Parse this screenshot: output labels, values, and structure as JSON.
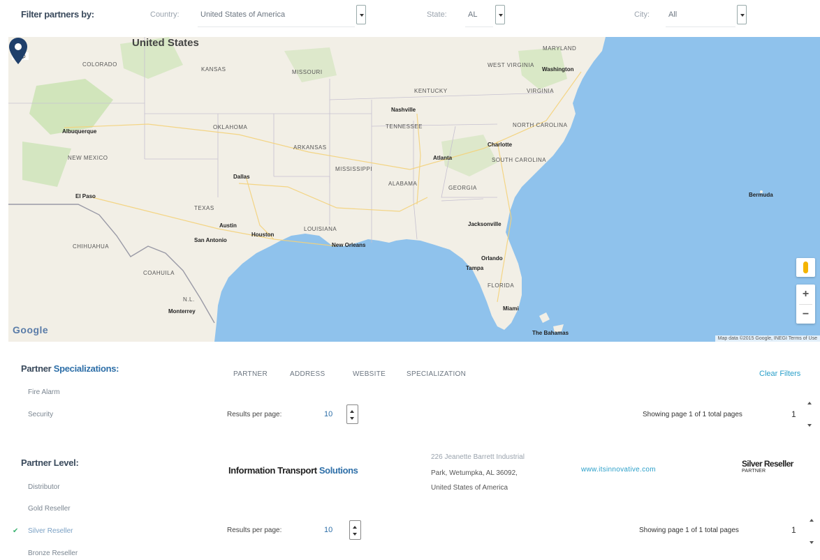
{
  "filters": {
    "title": "Filter partners by:",
    "country_label": "Country:",
    "country_value": "United States of America",
    "state_label": "State:",
    "state_value": "AL",
    "city_label": "City:",
    "city_value": "All"
  },
  "map": {
    "country_label": "United States",
    "map_type": "Map",
    "google_logo": "Google",
    "attribution": "Map data ©2015 Google, INEGI   Terms of Use",
    "zoom_in": "+",
    "zoom_out": "−",
    "colors": {
      "water": "#8fc2ec",
      "land": "#f2efe6",
      "park": "#c8e2b0",
      "marker": "#1f3f6b"
    },
    "state_labels": [
      "Colorado",
      "Kansas",
      "Missouri",
      "Kentucky",
      "Virginia",
      "Maryland",
      "West Virginia",
      "Tennessee",
      "North Carolina",
      "South Carolina",
      "Oklahoma",
      "Arkansas",
      "Mississippi",
      "Alabama",
      "Georgia",
      "Texas",
      "Louisiana",
      "Florida",
      "New Mexico",
      "Chihuahua",
      "Coahuila",
      "N.L."
    ],
    "city_labels": [
      "Washington",
      "Nashville",
      "Charlotte",
      "Atlanta",
      "Dallas",
      "Albuquerque",
      "El Paso",
      "Austin",
      "Houston",
      "San Antonio",
      "New Orleans",
      "Jacksonville",
      "Orlando",
      "Tampa",
      "Miami",
      "Monterrey",
      "The Bahamas",
      "Bermuda"
    ]
  },
  "sidebar": {
    "specializations": {
      "heading_prefix": "Partner",
      "heading_accent": "Specializations:",
      "items": [
        "Fire Alarm",
        "Security"
      ]
    },
    "partner_level": {
      "heading": "Partner Level:",
      "items": [
        {
          "label": "Distributor",
          "checked": false
        },
        {
          "label": "Gold Reseller",
          "checked": false
        },
        {
          "label": "Silver Reseller",
          "checked": true
        },
        {
          "label": "Bronze Reseller",
          "checked": false
        }
      ]
    }
  },
  "content": {
    "tabs": [
      "PARTNER",
      "ADDRESS",
      "WEBSITE",
      "SPECIALIZATION"
    ],
    "clear_filters": "Clear Filters",
    "results_per_page_label": "Results per page:",
    "results_per_page_value": "10",
    "showing_label": "Showing page 1 of 1 total pages",
    "page_number": "1",
    "result": {
      "name_prefix": "Information Transport",
      "name_accent": "Solutions",
      "address_line1": "226 Jeanette Barrett Industrial",
      "address_line2": "Park, Wetumpka, AL 36092,",
      "address_line3": "United States of America",
      "website": "www.itsinnovative.com",
      "badge_title": "Silver Reseller",
      "badge_sub": "PARTNER"
    }
  }
}
